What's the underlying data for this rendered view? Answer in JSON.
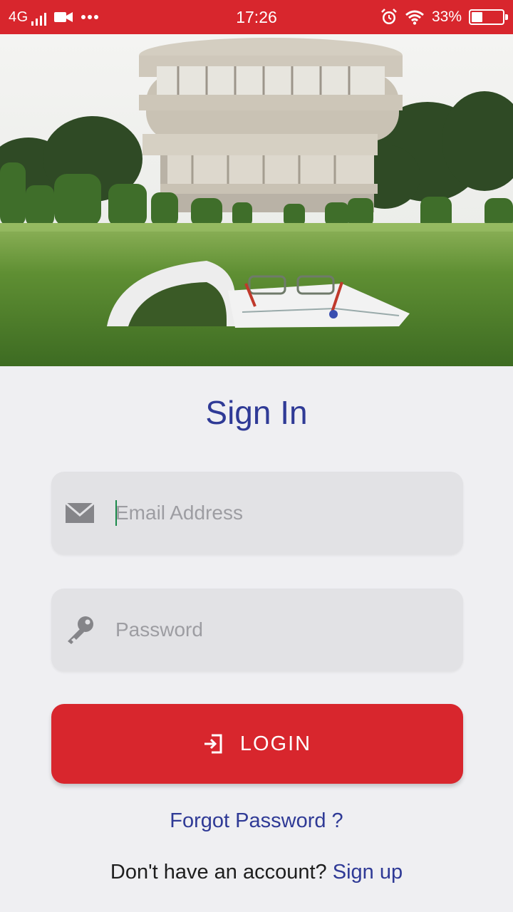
{
  "status_bar": {
    "network": "4G",
    "time": "17:26",
    "battery_percent": "33%",
    "battery_level": 0.33,
    "icons": [
      "signal-icon",
      "video-icon",
      "more-dots-icon",
      "alarm-icon",
      "wifi-icon",
      "battery-icon"
    ]
  },
  "hero": {
    "image": "campus-building-with-book-on-grass"
  },
  "signin": {
    "title": "Sign In",
    "email": {
      "placeholder": "Email Address",
      "value": "",
      "icon": "envelope-icon"
    },
    "password": {
      "placeholder": "Password",
      "value": "",
      "icon": "key-icon"
    },
    "login_button": {
      "label": "LOGIN",
      "icon": "login-arrow-icon"
    },
    "forgot_password": "Forgot Password ?",
    "signup_prompt": "Don't have an account?",
    "signup_link": "Sign up"
  },
  "colors": {
    "accent_red": "#d8262d",
    "link_blue": "#2f3a96",
    "page_bg": "#efeff2",
    "field_bg": "#e2e2e5"
  }
}
